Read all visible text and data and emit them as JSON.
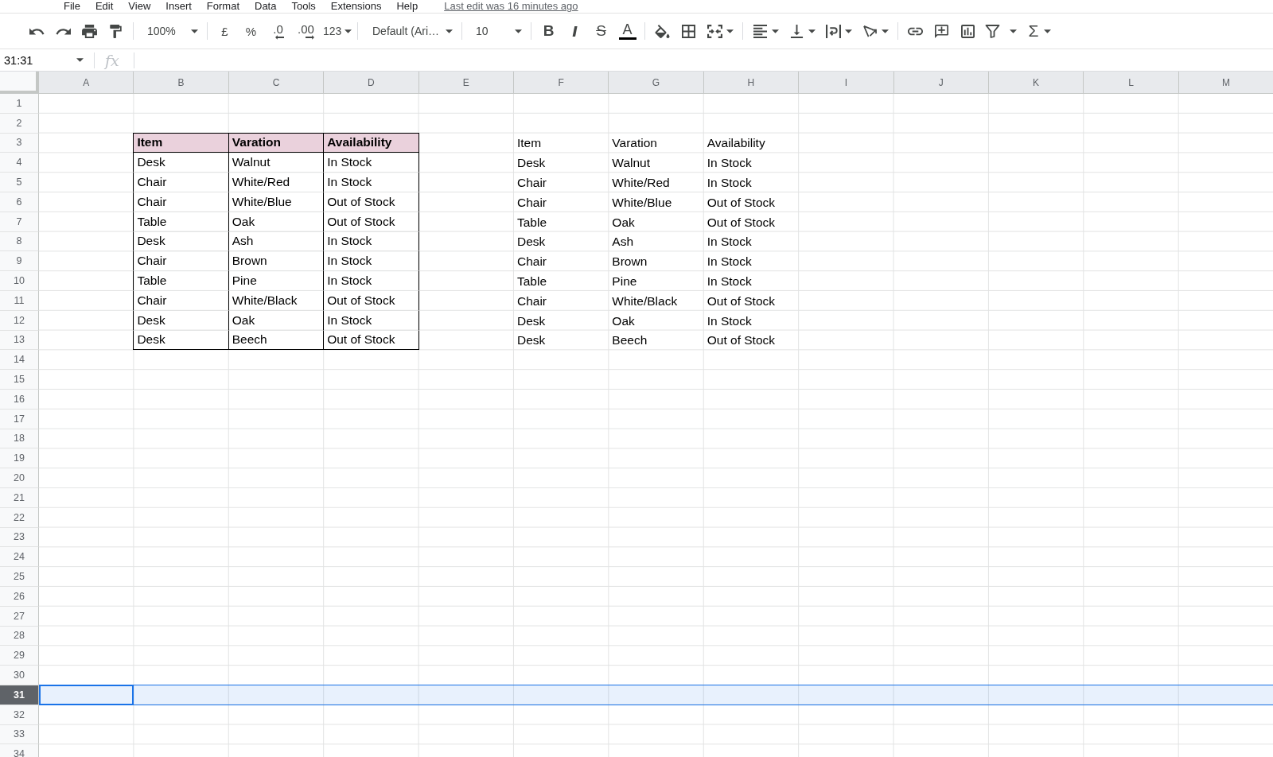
{
  "menu": [
    "File",
    "Edit",
    "View",
    "Insert",
    "Format",
    "Data",
    "Tools",
    "Extensions",
    "Help"
  ],
  "last_edit": "Last edit was 16 minutes ago",
  "toolbar": {
    "zoom": "100%",
    "currency": "£",
    "percent": "%",
    "decrease_decimal": ".0",
    "increase_decimal": ".00",
    "number_format": "123",
    "font": "Default (Ari…",
    "font_size": "10",
    "bold": "B",
    "italic": "I",
    "strikethrough": "S",
    "text_color": "A",
    "functions": "Σ"
  },
  "formula_bar": {
    "name_box": "31:31",
    "function_label": "fx"
  },
  "sheet": {
    "columns": [
      "A",
      "B",
      "C",
      "D",
      "E",
      "F",
      "G",
      "H",
      "I",
      "J",
      "K",
      "L",
      "M"
    ],
    "rows": [
      {
        "label": "1",
        "selected": false
      },
      {
        "label": "2",
        "selected": false
      },
      {
        "label": "3",
        "selected": false
      },
      {
        "label": "4",
        "selected": false
      },
      {
        "label": "5",
        "selected": false
      },
      {
        "label": "6",
        "selected": false
      },
      {
        "label": "7",
        "selected": false
      },
      {
        "label": "8",
        "selected": false
      },
      {
        "label": "9",
        "selected": false
      },
      {
        "label": "10",
        "selected": false
      },
      {
        "label": "11",
        "selected": false
      },
      {
        "label": "12",
        "selected": false
      },
      {
        "label": "13",
        "selected": false
      },
      {
        "label": "14",
        "selected": false
      },
      {
        "label": "15",
        "selected": false
      },
      {
        "label": "16",
        "selected": false
      },
      {
        "label": "17",
        "selected": false
      },
      {
        "label": "18",
        "selected": false
      },
      {
        "label": "19",
        "selected": false
      },
      {
        "label": "20",
        "selected": false
      },
      {
        "label": "21",
        "selected": false
      },
      {
        "label": "22",
        "selected": false
      },
      {
        "label": "23",
        "selected": false
      },
      {
        "label": "24",
        "selected": false
      },
      {
        "label": "25",
        "selected": false
      },
      {
        "label": "26",
        "selected": false
      },
      {
        "label": "27",
        "selected": false
      },
      {
        "label": "28",
        "selected": false
      },
      {
        "label": "29",
        "selected": false
      },
      {
        "label": "30",
        "selected": false
      },
      {
        "label": "31",
        "selected": true
      },
      {
        "label": "32",
        "selected": false
      },
      {
        "label": "33",
        "selected": false
      },
      {
        "label": "34",
        "selected": false
      }
    ],
    "tables": [
      {
        "kind": "formatted",
        "columns": [
          "Item",
          "Varation",
          "Availability"
        ],
        "rows": [
          [
            "Desk",
            "Walnut",
            "In Stock"
          ],
          [
            "Chair",
            "White/Red",
            "In Stock"
          ],
          [
            "Chair",
            "White/Blue",
            "Out of Stock"
          ],
          [
            "Table",
            "Oak",
            "Out of Stock"
          ],
          [
            "Desk",
            "Ash",
            "In Stock"
          ],
          [
            "Chair",
            "Brown",
            "In Stock"
          ],
          [
            "Table",
            "Pine",
            "In Stock"
          ],
          [
            "Chair",
            "White/Black",
            "Out of Stock"
          ],
          [
            "Desk",
            "Oak",
            "In Stock"
          ],
          [
            "Desk",
            "Beech",
            "Out of Stock"
          ]
        ]
      },
      {
        "kind": "plain",
        "columns": [
          "Item",
          "Varation",
          "Availability"
        ],
        "rows": [
          [
            "Desk",
            "Walnut",
            "In Stock"
          ],
          [
            "Chair",
            "White/Red",
            "In Stock"
          ],
          [
            "Chair",
            "White/Blue",
            "Out of Stock"
          ],
          [
            "Table",
            "Oak",
            "Out of Stock"
          ],
          [
            "Desk",
            "Ash",
            "In Stock"
          ],
          [
            "Chair",
            "Brown",
            "In Stock"
          ],
          [
            "Table",
            "Pine",
            "In Stock"
          ],
          [
            "Chair",
            "White/Black",
            "Out of Stock"
          ],
          [
            "Desk",
            "Oak",
            "In Stock"
          ],
          [
            "Desk",
            "Beech",
            "Out of Stock"
          ]
        ]
      }
    ]
  }
}
